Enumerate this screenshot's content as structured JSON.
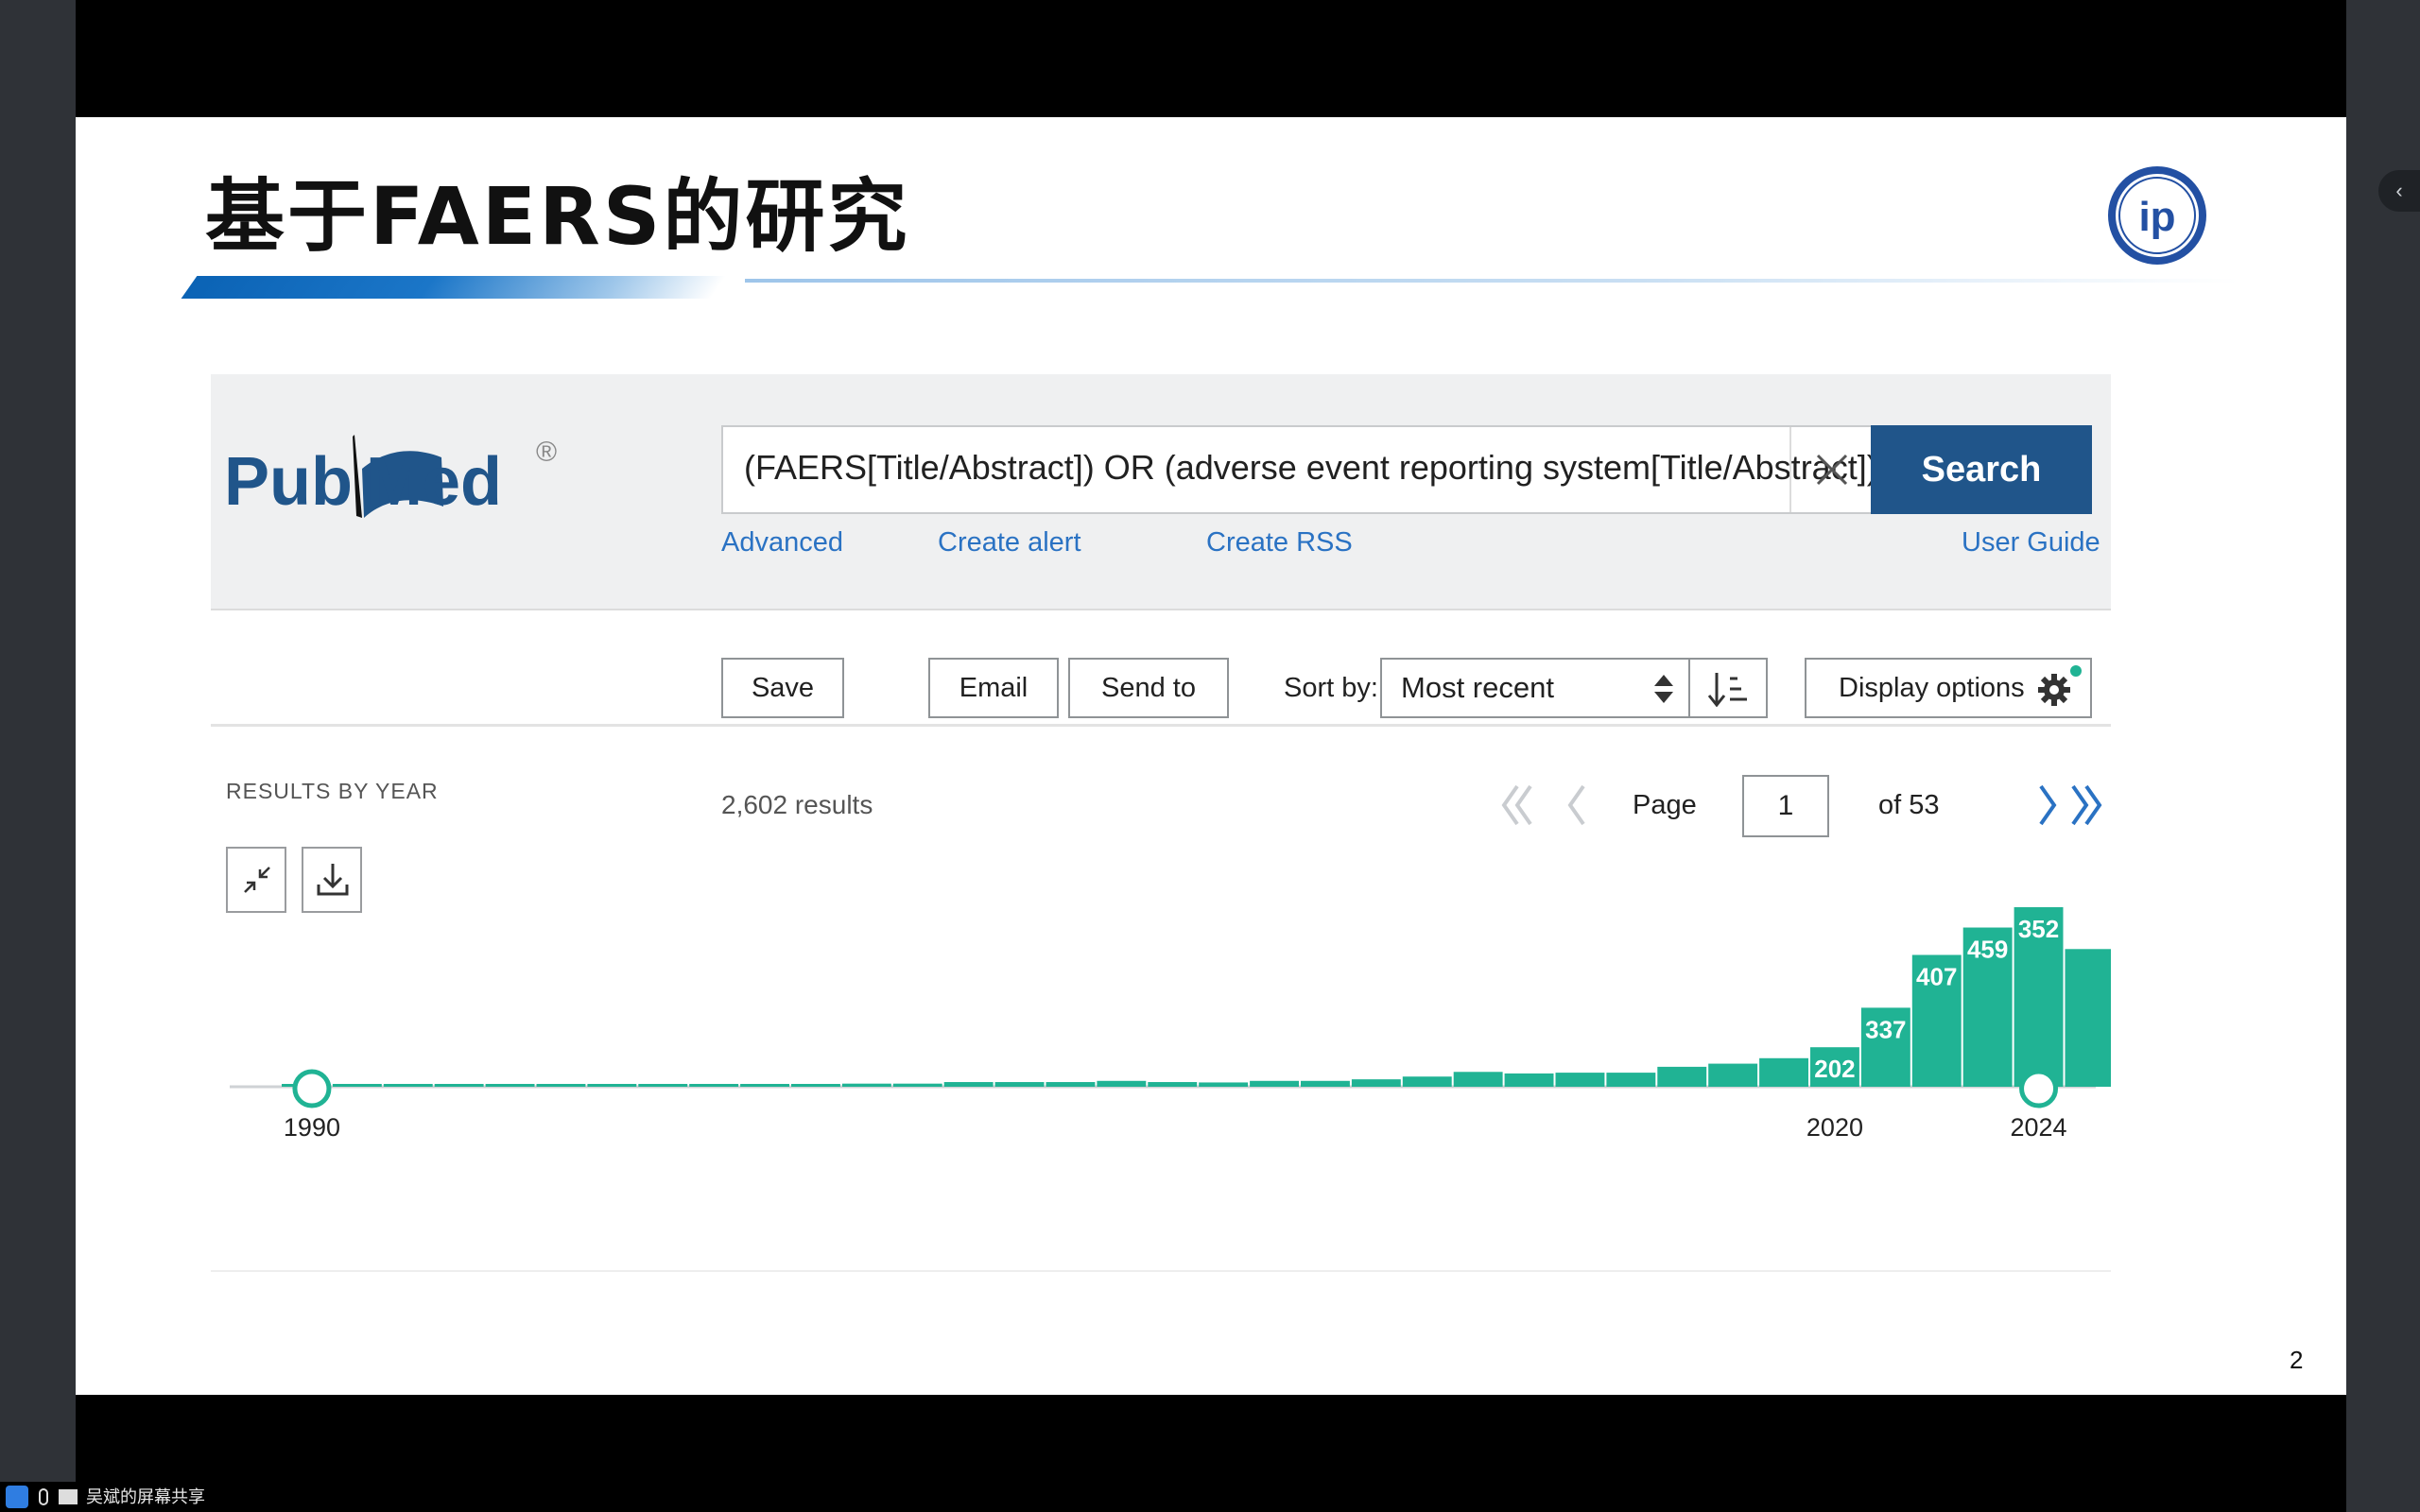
{
  "slide": {
    "title": "基于FAERS的研究",
    "page_number": "2",
    "logo_initials": "ip"
  },
  "pubmed": {
    "search_query": "(FAERS[Title/Abstract]) OR (adverse event reporting system[Title/Abstract])",
    "search_button": "Search",
    "links": {
      "advanced": "Advanced",
      "create_alert": "Create alert",
      "create_rss": "Create RSS",
      "user_guide": "User Guide"
    },
    "toolbar": {
      "save": "Save",
      "email": "Email",
      "send_to": "Send to",
      "sort_by_label": "Sort by:",
      "sort_value": "Most recent",
      "display_options": "Display options"
    },
    "results_by_year_label": "RESULTS BY YEAR",
    "results_count": "2,602 results",
    "pagination": {
      "page_label": "Page",
      "current_page": "1",
      "of_label": "of 53"
    }
  },
  "chart_data": {
    "type": "bar",
    "title": "RESULTS BY YEAR",
    "x": [
      1990,
      1991,
      1992,
      1993,
      1994,
      1995,
      1996,
      1997,
      1998,
      1999,
      2000,
      2001,
      2002,
      2003,
      2004,
      2005,
      2006,
      2007,
      2008,
      2009,
      2010,
      2011,
      2012,
      2013,
      2014,
      2015,
      2016,
      2017,
      2018,
      2019,
      2020,
      2021,
      2022,
      2023,
      2024
    ],
    "values": [
      2,
      2,
      2,
      2,
      3,
      3,
      3,
      4,
      5,
      5,
      6,
      8,
      8,
      12,
      12,
      12,
      15,
      12,
      11,
      15,
      15,
      19,
      26,
      38,
      34,
      36,
      36,
      51,
      59,
      73,
      101,
      202,
      337,
      407,
      459,
      352
    ],
    "data_labels": {
      "2020": "202",
      "2021": "337",
      "2022": "407",
      "2023": "459",
      "2024": "352"
    },
    "tick_labels": [
      "1990",
      "2020",
      "2024"
    ],
    "range_handles": [
      "1990",
      "2024"
    ],
    "ylim": [
      0,
      459
    ],
    "bar_color": "#20b394",
    "label_color": "#ffffff"
  },
  "colors": {
    "search_button": "#20558a",
    "link": "#2a72c3",
    "accent_dot": "#20b394"
  },
  "taskbar": {
    "share_label": "吴斌的屏幕共享"
  }
}
